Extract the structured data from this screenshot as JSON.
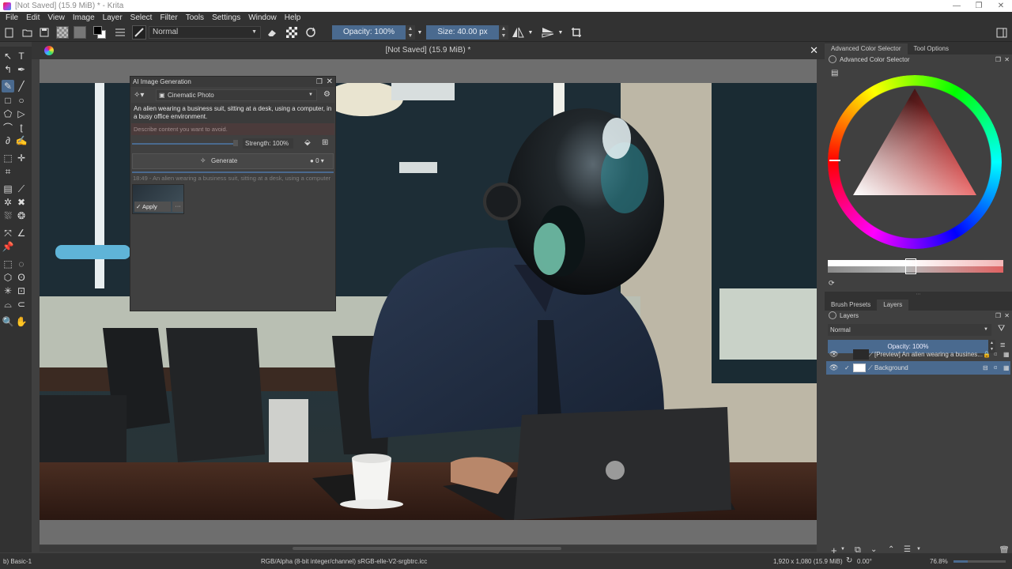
{
  "window": {
    "title": "[Not Saved]  (15.9 MiB) * - Krita",
    "minimize": "—",
    "maximize": "❐",
    "close": "✕"
  },
  "menu": [
    "File",
    "Edit",
    "View",
    "Image",
    "Layer",
    "Select",
    "Filter",
    "Tools",
    "Settings",
    "Window",
    "Help"
  ],
  "toolbar": {
    "blend_mode": "Normal",
    "opacity": "Opacity: 100%",
    "size": "Size: 40.00 px"
  },
  "document": {
    "tab_title": "[Not Saved]  (15.9 MiB) *"
  },
  "ai_panel": {
    "title": "AI Image Generation",
    "style": "Cinematic Photo",
    "prompt": "An alien wearing a business suit, sitting at a desk, using a computer, in a busy office environment.",
    "negative_placeholder": "Describe content you want to avoid.",
    "strength": "Strength: 100%",
    "generate": "Generate",
    "queue_count": "0",
    "history_entry": "18:49 - An alien wearing a business suit, sitting at a desk, using a computer",
    "apply": "Apply",
    "more": "···"
  },
  "right_dock": {
    "tabs": [
      "Advanced Color Selector",
      "Tool Options"
    ],
    "color_selector_title": "Advanced Color Selector",
    "bottom_tabs": [
      "Brush Presets",
      "Layers"
    ],
    "layers_title": "Layers",
    "blend_mode": "Normal",
    "opacity": "Opacity:  100%",
    "layers": [
      {
        "name": "[Preview] An alien wearing a busines...",
        "visible": true
      },
      {
        "name": "Background",
        "visible": true,
        "selected": true
      }
    ]
  },
  "status": {
    "brush": "b) Basic-1",
    "color_space": "RGB/Alpha (8-bit integer/channel)  sRGB-elle-V2-srgbtrc.icc",
    "dimensions": "1,920 x 1,080 (15.9 MiB)",
    "rotation": "0.00°",
    "zoom": "76.8%"
  },
  "colors": {
    "accent": "#4a6a8f",
    "panel": "#323232",
    "canvas_bg": "#6e6e6e"
  }
}
